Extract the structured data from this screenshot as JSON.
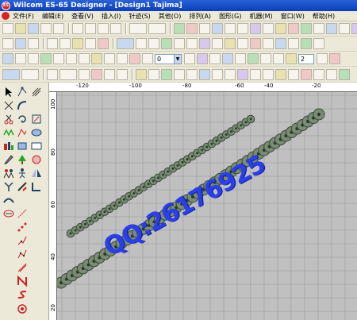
{
  "window": {
    "title": "Wilcom ES-65 Designer - [Design1    Tajima]",
    "logo_text": "ES"
  },
  "menu": [
    "文件(F)",
    "编辑(E)",
    "查看(V)",
    "插入(I)",
    "针迹(S)",
    "其他(O)",
    "排列(A)",
    "图形(G)",
    "机器(M)",
    "窗口(W)",
    "帮助(H)"
  ],
  "toolbar": {
    "zoom_value": "0",
    "count_value": "2"
  },
  "ruler": {
    "h_labels": [
      "-120",
      "-100",
      "-80",
      "-60",
      "-40",
      "-20"
    ],
    "v_labels": [
      "100",
      "80",
      "60",
      "40",
      "20"
    ]
  },
  "design": {
    "watermark_text": "QQ:26176925",
    "bead_count_upper": 38,
    "bead_count_lower": 48
  },
  "colors": {
    "bead_fill": "#7a8c74",
    "bead_stroke": "#3a4a3a",
    "upper_stroke": "#2a9a2a",
    "text_blue": "#2a3fe8",
    "grid": "#9a9a9a"
  }
}
